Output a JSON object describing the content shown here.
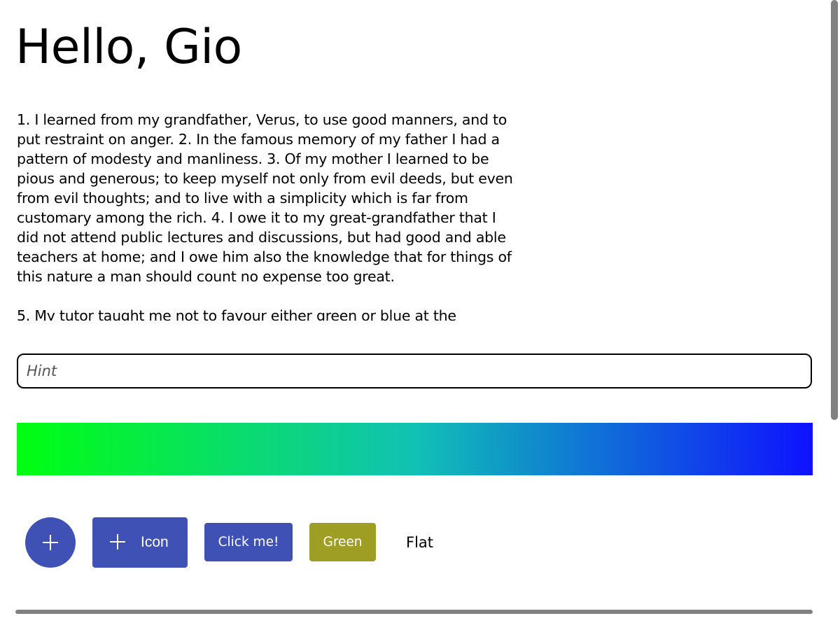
{
  "title": "Hello, Gio",
  "editor": {
    "paragraphs": [
      "1. I learned from my grandfather, Verus, to use good manners, and to\nput restraint on anger. 2. In the famous memory of my father I had a\npattern of modesty and manliness. 3. Of my mother I learned to be\npious and generous; to keep myself not only from evil deeds, but even\nfrom evil thoughts; and to live with a simplicity which is far from\ncustomary among the rich. 4. I owe it to my great-grandfather that I\ndid not attend public lectures and discussions, but had good and able\nteachers at home; and I owe him also the knowledge that for things of\nthis nature a man should count no expense too great.",
      "5. My tutor taught me not to favour either green or blue at the"
    ]
  },
  "input": {
    "placeholder": "Hint",
    "value": ""
  },
  "buttons": {
    "icon_label": "Icon",
    "click_label": "Click me!",
    "green_label": "Green",
    "flat_label": "Flat"
  },
  "progress": {
    "value": 1.0
  },
  "colors": {
    "primary": "#3f51b5",
    "green_button": "#9e9d24",
    "gradient_start": "#00ff11",
    "gradient_end": "#0f11ff",
    "progress": "#808080"
  },
  "icons": {
    "fab": "plus-icon",
    "icon_button": "plus-icon"
  }
}
